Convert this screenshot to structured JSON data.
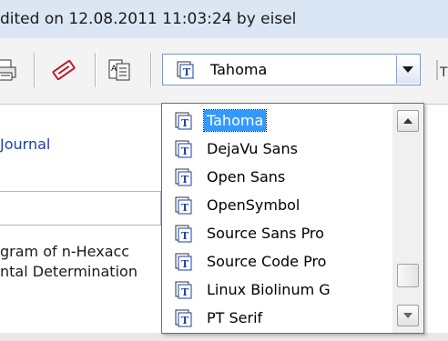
{
  "window": {
    "title_fragment": "dited on 12.08.2011 11:03:24 by eisel"
  },
  "toolbar": {
    "icons": [
      "printer-icon",
      "no-entry-icon",
      "font-book-icon"
    ],
    "font_combo": {
      "value": "Tahoma",
      "icon": "truetype-font-icon"
    }
  },
  "content": {
    "journal_label": "Journal",
    "body_lines": [
      "gram of n-Hexacc",
      "ntal Determination"
    ]
  },
  "font_dropdown": {
    "selected": "Tahoma",
    "items": [
      {
        "label": "Tahoma"
      },
      {
        "label": "DejaVu Sans"
      },
      {
        "label": "Open Sans"
      },
      {
        "label": "OpenSymbol"
      },
      {
        "label": "Source Sans Pro"
      },
      {
        "label": "Source Code Pro"
      },
      {
        "label": "Linux Biolinum G"
      },
      {
        "label": "PT Serif"
      }
    ]
  },
  "colors": {
    "selection": "#3399ff",
    "title_bg": "#dbe6f4",
    "link": "#1f3fa6"
  }
}
